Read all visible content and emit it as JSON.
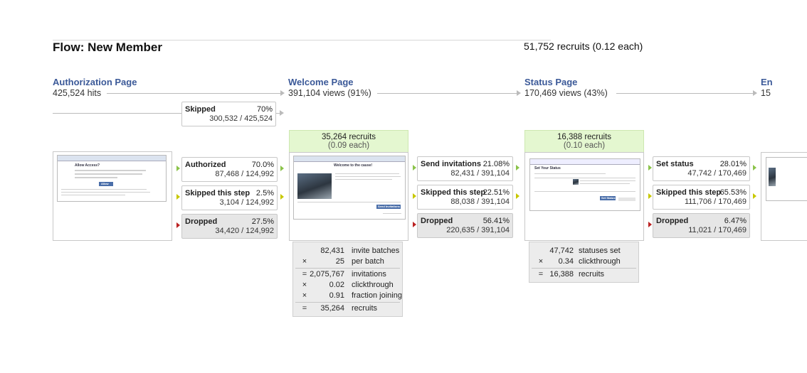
{
  "flow": {
    "title": "Flow: New Member",
    "recruits_total": "51,752 recruits (0.12 each)"
  },
  "stages": [
    {
      "title": "Authorization Page",
      "stat": "425,524 hits"
    },
    {
      "title": "Welcome Page",
      "stat": "391,104 views (91%)"
    },
    {
      "title": "Status Page",
      "stat": "170,469 views (43%)"
    },
    {
      "title": "En",
      "stat": "15"
    }
  ],
  "auth": {
    "skipped": {
      "label": "Skipped",
      "pct": "70%",
      "frac": "300,532 / 425,524"
    },
    "outcomes": [
      {
        "label": "Authorized",
        "pct": "70.0%",
        "frac": "87,468 / 124,992"
      },
      {
        "label": "Skipped this step",
        "pct": "2.5%",
        "frac": "3,104 / 124,992"
      },
      {
        "label": "Dropped",
        "pct": "27.5%",
        "frac": "34,420 / 124,992"
      }
    ],
    "thumb": {
      "title": "Allow Access?",
      "button": "Allow"
    }
  },
  "welcome": {
    "recruits": "35,264 recruits",
    "each": "(0.09 each)",
    "thumb": {
      "title": "Welcome to the cause!",
      "button": "Send Invitations"
    },
    "outcomes": [
      {
        "label": "Send invitations",
        "pct": "21.08%",
        "frac": "82,431 / 391,104"
      },
      {
        "label": "Skipped this step",
        "pct": "22.51%",
        "frac": "88,038 / 391,104"
      },
      {
        "label": "Dropped",
        "pct": "56.41%",
        "frac": "220,635 / 391,104"
      }
    ],
    "calc": [
      {
        "op": "",
        "num": "82,431",
        "name": "invite batches"
      },
      {
        "op": "×",
        "num": "25",
        "name": "per batch"
      },
      {
        "op": "=",
        "num": "2,075,767",
        "name": "invitations"
      },
      {
        "op": "×",
        "num": "0.02",
        "name": "clickthrough"
      },
      {
        "op": "×",
        "num": "0.91",
        "name": "fraction joining"
      },
      {
        "op": "=",
        "num": "35,264",
        "name": "recruits"
      }
    ]
  },
  "status": {
    "recruits": "16,388 recruits",
    "each": "(0.10 each)",
    "thumb": {
      "title": "Set Your Status",
      "button": "Set Status"
    },
    "outcomes": [
      {
        "label": "Set status",
        "pct": "28.01%",
        "frac": "47,742 / 170,469"
      },
      {
        "label": "Skipped this step",
        "pct": "65.53%",
        "frac": "111,706 / 170,469"
      },
      {
        "label": "Dropped",
        "pct": "6.47%",
        "frac": "11,021 / 170,469"
      }
    ],
    "calc": [
      {
        "op": "",
        "num": "47,742",
        "name": "statuses set"
      },
      {
        "op": "×",
        "num": "0.34",
        "name": "clickthrough"
      },
      {
        "op": "=",
        "num": "16,388",
        "name": "recruits"
      }
    ]
  },
  "colors": {
    "link": "#3b5998",
    "recruit_bg": "#e4f7d0",
    "dropped_bg": "#e6e6e6",
    "arrow_green": "#8bc34a",
    "arrow_yellow": "#c8c800",
    "arrow_red": "#b22222"
  }
}
